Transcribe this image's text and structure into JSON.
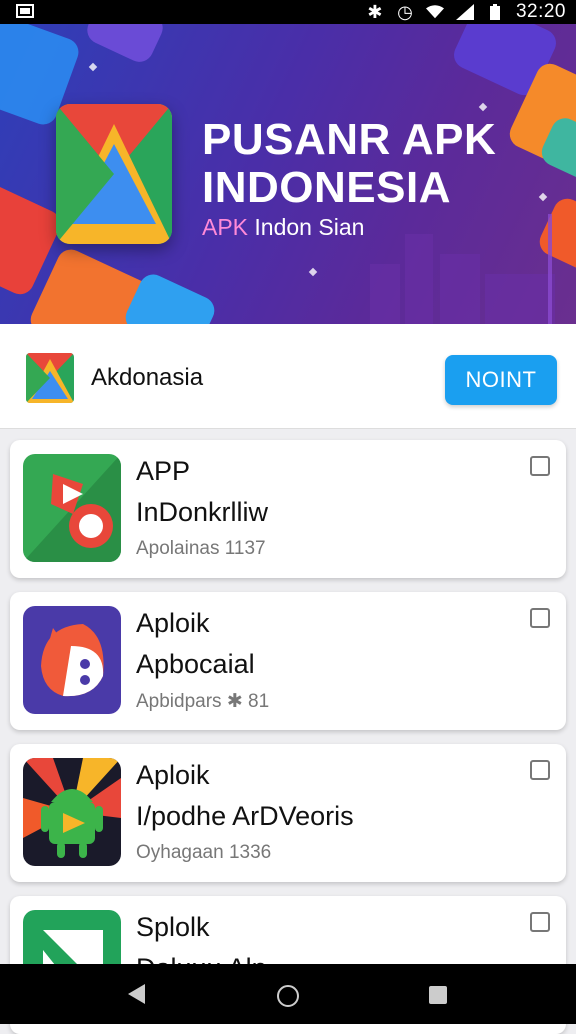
{
  "status_bar": {
    "time": "32:20",
    "icons": [
      "notification-icon",
      "bluetooth-icon",
      "alarm-icon",
      "wifi-icon",
      "signal-icon",
      "battery-icon"
    ]
  },
  "banner": {
    "title_line1": "PUSANR APK",
    "title_line2": "INDONESIA",
    "subtitle_highlight": "APK",
    "subtitle_rest": " Indon Sian"
  },
  "header": {
    "title": "Akdonasia",
    "button_label": "NOINT"
  },
  "apps": [
    {
      "name": "APP",
      "title": "InDonkrlliw",
      "meta": "Apolainas 1137",
      "icon": "app-1-icon"
    },
    {
      "name": "Aploik",
      "title": "Apbocaial",
      "meta": "Apbidpars ✱ 81",
      "icon": "app-2-icon"
    },
    {
      "name": "Aploik",
      "title": "I/podhe ArDVeoris",
      "meta": "Oyhagaan 1336",
      "icon": "app-3-icon"
    },
    {
      "name": "Splolk",
      "title": "Daluuu Aln",
      "meta": "",
      "icon": "app-4-icon"
    }
  ],
  "colors": {
    "accent": "#1a9ff0",
    "banner_start": "#2e3fb8",
    "banner_end": "#6a2f8f"
  }
}
